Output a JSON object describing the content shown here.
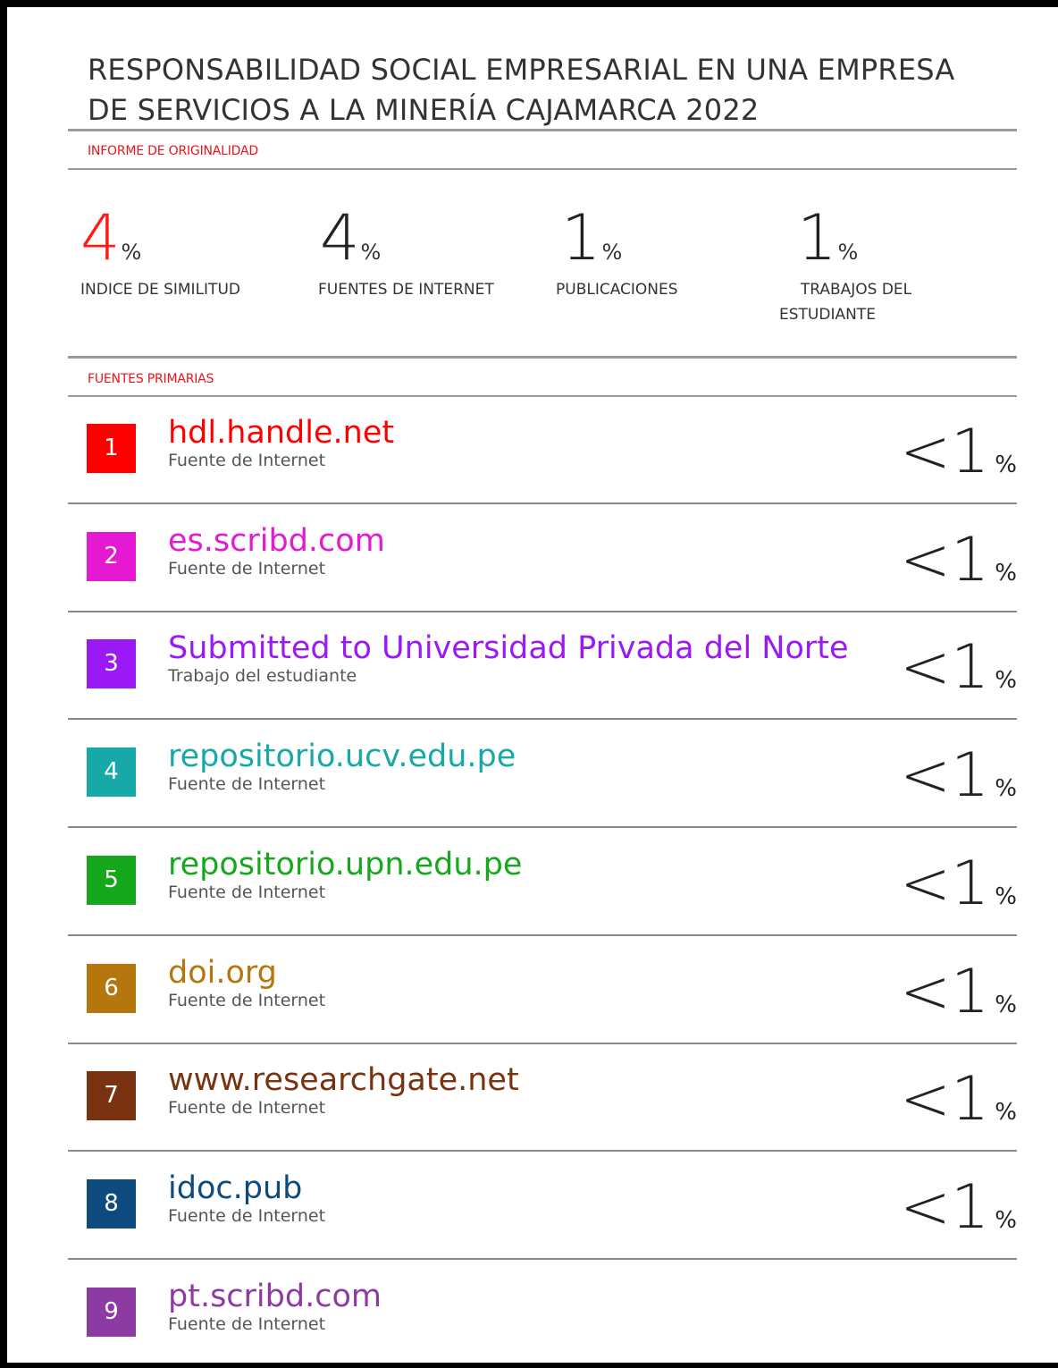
{
  "report": {
    "title_line1": "RESPONSABILIDAD SOCIAL EMPRESARIAL EN UNA EMPRESA",
    "title_line2": "DE SERVICIOS A LA MINERÍA CAJAMARCA 2022",
    "originality_label": "INFORME DE ORIGINALIDAD",
    "primary_sources_label": "FUENTES PRIMARIAS",
    "accent_color": "#e8141b"
  },
  "stats": [
    {
      "value": "4",
      "unit": "%",
      "label": "INDICE DE SIMILITUD"
    },
    {
      "value": "4",
      "unit": "%",
      "label": "FUENTES DE INTERNET"
    },
    {
      "value": "1",
      "unit": "%",
      "label": "PUBLICACIONES"
    },
    {
      "value": "1",
      "unit": "%",
      "label_line1": "TRABAJOS DEL",
      "label_line2": "ESTUDIANTE"
    }
  ],
  "sources": [
    {
      "number": "1",
      "name": "hdl.handle.net",
      "type": "Fuente de Internet",
      "pct_big": "<1",
      "pct_small": "%",
      "color": "#ff0000"
    },
    {
      "number": "2",
      "name": "es.scribd.com",
      "type": "Fuente de Internet",
      "pct_big": "<1",
      "pct_small": "%",
      "color": "#e619d2"
    },
    {
      "number": "3",
      "name": "Submitted to Universidad Privada del Norte",
      "type": "Trabajo del estudiante",
      "pct_big": "<1",
      "pct_small": "%",
      "color": "#9a19f5"
    },
    {
      "number": "4",
      "name": "repositorio.ucv.edu.pe",
      "type": "Fuente de Internet",
      "pct_big": "<1",
      "pct_small": "%",
      "color": "#17a8a8"
    },
    {
      "number": "5",
      "name": "repositorio.upn.edu.pe",
      "type": "Fuente de Internet",
      "pct_big": "<1",
      "pct_small": "%",
      "color": "#16a81c"
    },
    {
      "number": "6",
      "name": "doi.org",
      "type": "Fuente de Internet",
      "pct_big": "<1",
      "pct_small": "%",
      "color": "#b5760e"
    },
    {
      "number": "7",
      "name": "www.researchgate.net",
      "type": "Fuente de Internet",
      "pct_big": "<1",
      "pct_small": "%",
      "color": "#7a3310"
    },
    {
      "number": "8",
      "name": "idoc.pub",
      "type": "Fuente de Internet",
      "pct_big": "<1",
      "pct_small": "%",
      "color": "#0d4a7e"
    },
    {
      "number": "9",
      "name": "pt.scribd.com",
      "type": "Fuente de Internet",
      "pct_big": "",
      "pct_small": "",
      "color": "#8e3aa3"
    }
  ]
}
